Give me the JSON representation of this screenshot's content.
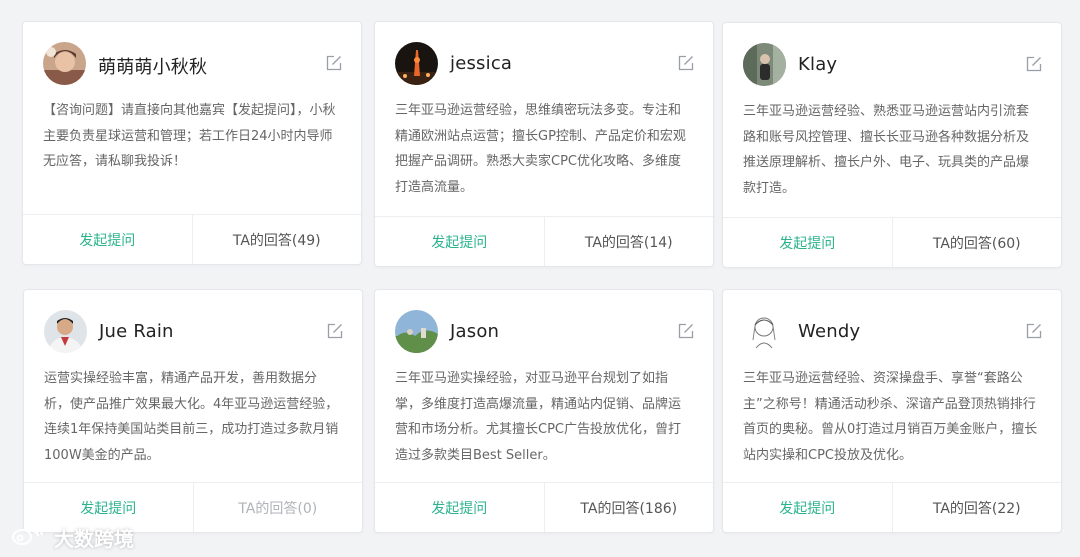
{
  "colors": {
    "background": "#f2f3f5",
    "card": "#ffffff",
    "accent": "#2bb38c",
    "text_primary": "#222222",
    "text_secondary": "#666666",
    "muted": "#b0b3b8"
  },
  "cards": [
    {
      "name": "萌萌萌小秋秋",
      "avatar": "avatar-photo-person",
      "description": "【咨询问题】请直接向其他嘉宾【发起提问】，小秋主要负责星球运营和管理；若工作日24小时内导师无应答，请私聊我投诉！",
      "ask_label": "发起提问",
      "answers_label": "TA的回答(49)"
    },
    {
      "name": "jessica",
      "avatar": "avatar-photo-night-tower",
      "description": "三年亚马逊运营经验，思维缜密玩法多变。专注和精通欧洲站点运营；擅长GP控制、产品定价和宏观把握产品调研。熟悉大卖家CPC优化攻略、多维度打造高流量。",
      "ask_label": "发起提问",
      "answers_label": "TA的回答(14)"
    },
    {
      "name": "Klay",
      "avatar": "avatar-photo-street",
      "description": "三年亚马逊运营经验、熟悉亚马逊运营站内引流套路和账号风控管理、擅长长亚马逊各种数据分析及推送原理解析、擅长户外、电子、玩具类的产品爆款打造。",
      "ask_label": "发起提问",
      "answers_label": "TA的回答(60)"
    },
    {
      "name": "Jue Rain",
      "avatar": "avatar-photo-man",
      "description": "运营实操经验丰富，精通产品开发，善用数据分析，使产品推广效果最大化。4年亚马逊运营经验，连续1年保持美国站类目前三，成功打造过多款月销100W美金的产品。",
      "ask_label": "发起提问",
      "answers_label": "TA的回答(0)"
    },
    {
      "name": "Jason",
      "avatar": "avatar-photo-landscape",
      "description": "三年亚马逊实操经验，对亚马逊平台规划了如指掌，多维度打造高爆流量，精通站内促销、品牌运营和市场分析。尤其擅长CPC广告投放优化，曾打造过多款类目Best Seller。",
      "ask_label": "发起提问",
      "answers_label": "TA的回答(186)"
    },
    {
      "name": "Wendy",
      "avatar": "avatar-sketch-girl",
      "description": "三年亚马逊运营经验、资深操盘手、享誉“套路公主”之称号！精通活动秒杀、深谙产品登顶热销排行首页的奥秘。曾从0打造过月销百万美金账户，擅长站内实操和CPC投放及优化。",
      "ask_label": "发起提问",
      "answers_label": "TA的回答(22)"
    }
  ],
  "watermark": {
    "text": "大数跨境",
    "logo": "weibo-style-logo"
  }
}
